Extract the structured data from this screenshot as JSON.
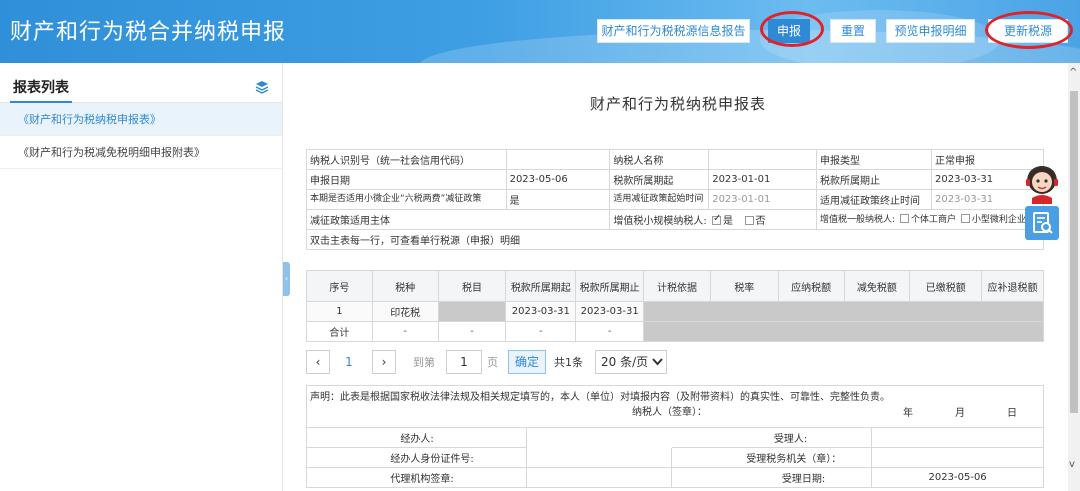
{
  "header": {
    "title": "财产和行为税合并纳税申报",
    "buttons": {
      "source_report": "财产和行为税税源信息报告",
      "declare": "申报",
      "reset": "重置",
      "preview": "预览申报明细",
      "update_source": "更新税源"
    }
  },
  "sidebar": {
    "title": "报表列表",
    "items": [
      {
        "label": "《财产和行为税纳税申报表》"
      },
      {
        "label": "《财产和行为税减免税明细申报附表》"
      }
    ]
  },
  "form": {
    "title": "财产和行为税纳税申报表",
    "info": {
      "taxpayer_id_label": "纳税人识别号（统一社会信用代码）",
      "taxpayer_id_value": "",
      "taxpayer_name_label": "纳税人名称",
      "taxpayer_name_value": "",
      "decl_type_label": "申报类型",
      "decl_type_value": "正常申报",
      "decl_date_label": "申报日期",
      "decl_date_value": "2023-05-06",
      "period_start_label": "税款所属期起",
      "period_start_value": "2023-01-01",
      "period_end_label": "税款所属期止",
      "period_end_value": "2023-03-31",
      "policy_label": "本期是否适用小微企业“六税两费”减征政策",
      "policy_value": "是",
      "policy_start_label": "适用减征政策起始时间",
      "policy_start_value": "2023-01-01",
      "policy_end_label": "适用减征政策终止时间",
      "policy_end_value": "2023-03-31",
      "subject_label": "减征政策适用主体",
      "small_taxpayer_label": "增值税小规模纳税人:",
      "yes_label": "是",
      "no_label": "否",
      "general_taxpayer_label": "增值税一般纳税人:",
      "individual_label": "个体工商户",
      "small_micro_label": "小型微利企业",
      "hint": "双击主表每一行，可查看单行税源（申报）明细"
    },
    "table": {
      "headers": [
        "序号",
        "税种",
        "税目",
        "税款所属期起",
        "税款所属期止",
        "计税依据",
        "税率",
        "应纳税额",
        "减免税额",
        "已缴税额",
        "应补退税额"
      ],
      "rows": [
        {
          "no": "1",
          "tax": "印花税",
          "item": "",
          "start": "2023-03-31",
          "end": "2023-03-31"
        },
        {
          "no": "合计",
          "tax": "-",
          "item": "-",
          "start": "-",
          "end": "-"
        }
      ]
    },
    "pager": {
      "current": "1",
      "goto_label": "到第",
      "page_input": "1",
      "page_unit": "页",
      "confirm": "确定",
      "total": "共1条",
      "page_size": "20 条/页"
    },
    "footer": {
      "declaration": "声明：此表是根据国家税收法律法规及相关规定填写的，本人（单位）对填报内容（及附带资料）的真实性、可靠性、完整性负责。",
      "signature_label": "纳税人（签章）：",
      "year": "年",
      "month": "月",
      "day": "日",
      "agent_label": "经办人:",
      "agent_id_label": "经办人身份证件号:",
      "agency_seal_label": "代理机构签章:",
      "receiver_label": "受理人:",
      "receiving_office_label": "受理税务机关（章）：",
      "receive_date_label": "受理日期:",
      "receive_date_value": "2023-05-06"
    }
  },
  "colors": {
    "accent": "#2f8ad6",
    "highlight_ring": "#e0222a"
  }
}
